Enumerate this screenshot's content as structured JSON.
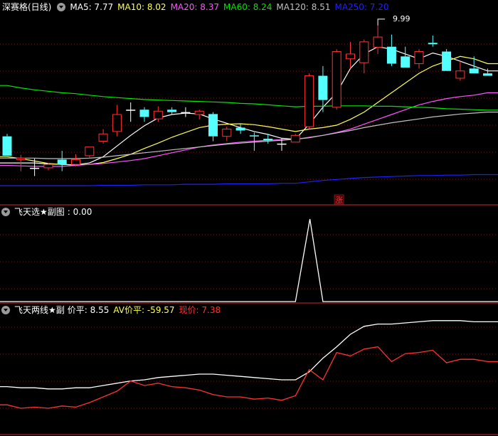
{
  "colors": {
    "up": "#ff3232",
    "down": "#54ffff",
    "flat": "#ffffff",
    "ma5": "#ffffff",
    "ma10": "#ffff54",
    "ma20": "#ff54ff",
    "ma60": "#00e600",
    "ma120": "#c0c0c0",
    "ma250": "#2020ff",
    "grid": "#7a1a1a",
    "separator": "#8b1a1a",
    "vp": "#ffffff",
    "avvp": "#ffff54",
    "xj": "#ff3232"
  },
  "panel_main": {
    "title": "深赛格(日线)",
    "legend": [
      {
        "label": "MA5: 7.77",
        "color": "#ffffff"
      },
      {
        "label": "MA10: 8.02",
        "color": "#ffff54"
      },
      {
        "label": "MA20: 8.37",
        "color": "#ff54ff"
      },
      {
        "label": "MA60: 8.24",
        "color": "#00e600"
      },
      {
        "label": "MA120: 8.51",
        "color": "#c0c0c0"
      },
      {
        "label": "MA250: 7.20",
        "color": "#2020ff"
      }
    ],
    "high_label": "9.99",
    "zhang_label": "涨"
  },
  "panel_sub1": {
    "title": "飞天选★副图",
    "value_label": ": 0.00"
  },
  "panel_sub2": {
    "title": "飞天两线★副",
    "legend": [
      {
        "label": "价平: 8.55",
        "color": "#ffffff"
      },
      {
        "label": "AV价平: -59.57",
        "color": "#ffff54"
      },
      {
        "label": "现价: 7.38",
        "color": "#ff3232"
      }
    ]
  },
  "chart_data": [
    {
      "type": "candlestick",
      "title": "深赛格(日线)",
      "price_range": [
        6.55,
        10.25
      ],
      "candles": [
        {
          "o": 7.7,
          "h": 7.75,
          "l": 7.3,
          "c": 7.3
        },
        {
          "o": 7.22,
          "h": 7.32,
          "l": 6.98,
          "c": 7.25
        },
        {
          "o": 7.05,
          "h": 7.24,
          "l": 6.88,
          "c": 7.05
        },
        {
          "o": 7.05,
          "h": 7.15,
          "l": 7.0,
          "c": 7.12
        },
        {
          "o": 7.22,
          "h": 7.4,
          "l": 6.98,
          "c": 7.12
        },
        {
          "o": 7.12,
          "h": 7.33,
          "l": 7.08,
          "c": 7.22
        },
        {
          "o": 7.3,
          "h": 7.4,
          "l": 7.25,
          "c": 7.48
        },
        {
          "o": 7.6,
          "h": 7.85,
          "l": 7.55,
          "c": 7.75
        },
        {
          "o": 7.8,
          "h": 8.35,
          "l": 7.7,
          "c": 8.15
        },
        {
          "o": 8.25,
          "h": 8.4,
          "l": 8.0,
          "c": 8.25
        },
        {
          "o": 8.25,
          "h": 8.3,
          "l": 8.0,
          "c": 8.1
        },
        {
          "o": 8.06,
          "h": 8.32,
          "l": 8.0,
          "c": 8.22
        },
        {
          "o": 8.25,
          "h": 8.3,
          "l": 8.15,
          "c": 8.2
        },
        {
          "o": 8.2,
          "h": 8.3,
          "l": 8.1,
          "c": 8.2
        },
        {
          "o": 8.15,
          "h": 8.25,
          "l": 8.05,
          "c": 8.22
        },
        {
          "o": 8.16,
          "h": 8.2,
          "l": 7.6,
          "c": 7.7
        },
        {
          "o": 7.7,
          "h": 7.9,
          "l": 7.6,
          "c": 7.85
        },
        {
          "o": 7.88,
          "h": 7.95,
          "l": 7.75,
          "c": 7.82
        },
        {
          "o": 7.72,
          "h": 7.78,
          "l": 7.4,
          "c": 7.7
        },
        {
          "o": 7.65,
          "h": 7.75,
          "l": 7.55,
          "c": 7.62
        },
        {
          "o": 7.55,
          "h": 7.65,
          "l": 7.4,
          "c": 7.55
        },
        {
          "o": 7.58,
          "h": 7.75,
          "l": 7.58,
          "c": 7.72
        },
        {
          "o": 7.9,
          "h": 9.0,
          "l": 7.85,
          "c": 8.95
        },
        {
          "o": 8.95,
          "h": 9.15,
          "l": 8.2,
          "c": 8.45
        },
        {
          "o": 8.3,
          "h": 9.5,
          "l": 8.25,
          "c": 9.45
        },
        {
          "o": 9.3,
          "h": 9.65,
          "l": 9.1,
          "c": 9.4
        },
        {
          "o": 9.22,
          "h": 9.7,
          "l": 9.0,
          "c": 9.65
        },
        {
          "o": 9.54,
          "h": 9.99,
          "l": 9.4,
          "c": 9.75
        },
        {
          "o": 9.55,
          "h": 9.8,
          "l": 9.15,
          "c": 9.2
        },
        {
          "o": 9.35,
          "h": 9.55,
          "l": 9.15,
          "c": 9.12
        },
        {
          "o": 9.2,
          "h": 9.5,
          "l": 9.1,
          "c": 9.45
        },
        {
          "o": 9.63,
          "h": 9.78,
          "l": 9.55,
          "c": 9.6
        },
        {
          "o": 9.45,
          "h": 9.5,
          "l": 9.05,
          "c": 9.05
        },
        {
          "o": 8.9,
          "h": 9.25,
          "l": 8.85,
          "c": 9.05
        },
        {
          "o": 9.1,
          "h": 9.35,
          "l": 9.0,
          "c": 9.0
        },
        {
          "o": 9.0,
          "h": 9.1,
          "l": 8.95,
          "c": 8.95
        }
      ],
      "ma_series": [
        {
          "name": "MA5",
          "values": [
            7.15,
            7.15,
            7.15,
            7.13,
            7.12,
            7.11,
            7.15,
            7.28,
            7.5,
            7.72,
            7.92,
            8.08,
            8.15,
            8.18,
            8.16,
            8.06,
            7.97,
            7.88,
            7.8,
            7.74,
            7.66,
            7.64,
            7.95,
            8.3,
            8.6,
            9.1,
            9.4,
            9.55,
            9.5,
            9.4,
            9.3,
            9.42,
            9.35,
            9.25,
            9.15,
            9.05
          ]
        },
        {
          "name": "MA10",
          "values": [
            7.28,
            7.24,
            7.19,
            7.14,
            7.12,
            7.11,
            7.12,
            7.16,
            7.24,
            7.33,
            7.45,
            7.56,
            7.68,
            7.78,
            7.88,
            7.93,
            7.95,
            7.96,
            7.94,
            7.9,
            7.85,
            7.8,
            7.85,
            7.88,
            7.93,
            8.05,
            8.2,
            8.4,
            8.6,
            8.8,
            9.0,
            9.15,
            9.25,
            9.35,
            9.3,
            9.2
          ]
        },
        {
          "name": "MA20",
          "values": [
            7.1,
            7.09,
            7.08,
            7.08,
            7.08,
            7.1,
            7.12,
            7.14,
            7.17,
            7.2,
            7.24,
            7.3,
            7.36,
            7.42,
            7.48,
            7.52,
            7.55,
            7.58,
            7.6,
            7.62,
            7.63,
            7.64,
            7.68,
            7.72,
            7.78,
            7.85,
            7.95,
            8.05,
            8.15,
            8.25,
            8.35,
            8.42,
            8.48,
            8.52,
            8.55,
            8.6
          ]
        },
        {
          "name": "MA60",
          "values": [
            8.75,
            8.7,
            8.66,
            8.63,
            8.6,
            8.58,
            8.55,
            8.52,
            8.5,
            8.48,
            8.46,
            8.45,
            8.44,
            8.43,
            8.42,
            8.41,
            8.4,
            8.38,
            8.37,
            8.35,
            8.33,
            8.31,
            8.32,
            8.32,
            8.33,
            8.33,
            8.33,
            8.32,
            8.32,
            8.31,
            8.3,
            8.29,
            8.27,
            8.26,
            8.25,
            8.24
          ]
        },
        {
          "name": "MA120",
          "values": [
            7.25,
            7.25,
            7.25,
            7.24,
            7.24,
            7.24,
            7.25,
            7.27,
            7.3,
            7.33,
            7.36,
            7.39,
            7.42,
            7.45,
            7.48,
            7.51,
            7.54,
            7.56,
            7.58,
            7.6,
            7.62,
            7.64,
            7.67,
            7.72,
            7.77,
            7.82,
            7.88,
            7.93,
            7.98,
            8.02,
            8.06,
            8.1,
            8.13,
            8.16,
            8.18,
            8.2
          ]
        },
        {
          "name": "MA250",
          "values": [
            6.68,
            6.68,
            6.68,
            6.68,
            6.68,
            6.68,
            6.68,
            6.69,
            6.69,
            6.69,
            6.7,
            6.7,
            6.7,
            6.71,
            6.71,
            6.71,
            6.72,
            6.72,
            6.72,
            6.72,
            6.73,
            6.73,
            6.76,
            6.79,
            6.81,
            6.83,
            6.85,
            6.86,
            6.87,
            6.88,
            6.89,
            6.89,
            6.9,
            6.9,
            6.91,
            6.91
          ]
        }
      ]
    },
    {
      "type": "line",
      "title": "飞天选★副图",
      "ylim": [
        0,
        1
      ],
      "series": [
        {
          "name": "",
          "values": [
            0,
            0,
            0,
            0,
            0,
            0,
            0,
            0,
            0,
            0,
            0,
            0,
            0,
            0,
            0,
            0,
            0,
            0,
            0,
            0,
            0,
            0,
            1,
            0,
            0,
            0,
            0,
            0,
            0,
            0,
            0,
            0,
            0,
            0,
            0,
            0
          ]
        }
      ]
    },
    {
      "type": "line",
      "title": "飞天两线★副",
      "ylim": [
        0,
        1
      ],
      "series": [
        {
          "name": "价平",
          "values": [
            0.39,
            0.38,
            0.38,
            0.37,
            0.37,
            0.38,
            0.38,
            0.4,
            0.42,
            0.44,
            0.45,
            0.47,
            0.48,
            0.49,
            0.5,
            0.5,
            0.49,
            0.48,
            0.47,
            0.46,
            0.45,
            0.45,
            0.52,
            0.64,
            0.74,
            0.85,
            0.92,
            0.94,
            0.94,
            0.95,
            0.96,
            0.97,
            0.97,
            0.97,
            0.96,
            0.96
          ]
        },
        {
          "name": "现价",
          "values": [
            0.23,
            0.2,
            0.21,
            0.2,
            0.22,
            0.21,
            0.25,
            0.3,
            0.35,
            0.44,
            0.4,
            0.42,
            0.39,
            0.38,
            0.36,
            0.32,
            0.3,
            0.3,
            0.28,
            0.29,
            0.27,
            0.31,
            0.54,
            0.45,
            0.69,
            0.66,
            0.72,
            0.74,
            0.61,
            0.68,
            0.69,
            0.71,
            0.6,
            0.63,
            0.63,
            0.61
          ]
        }
      ]
    }
  ]
}
